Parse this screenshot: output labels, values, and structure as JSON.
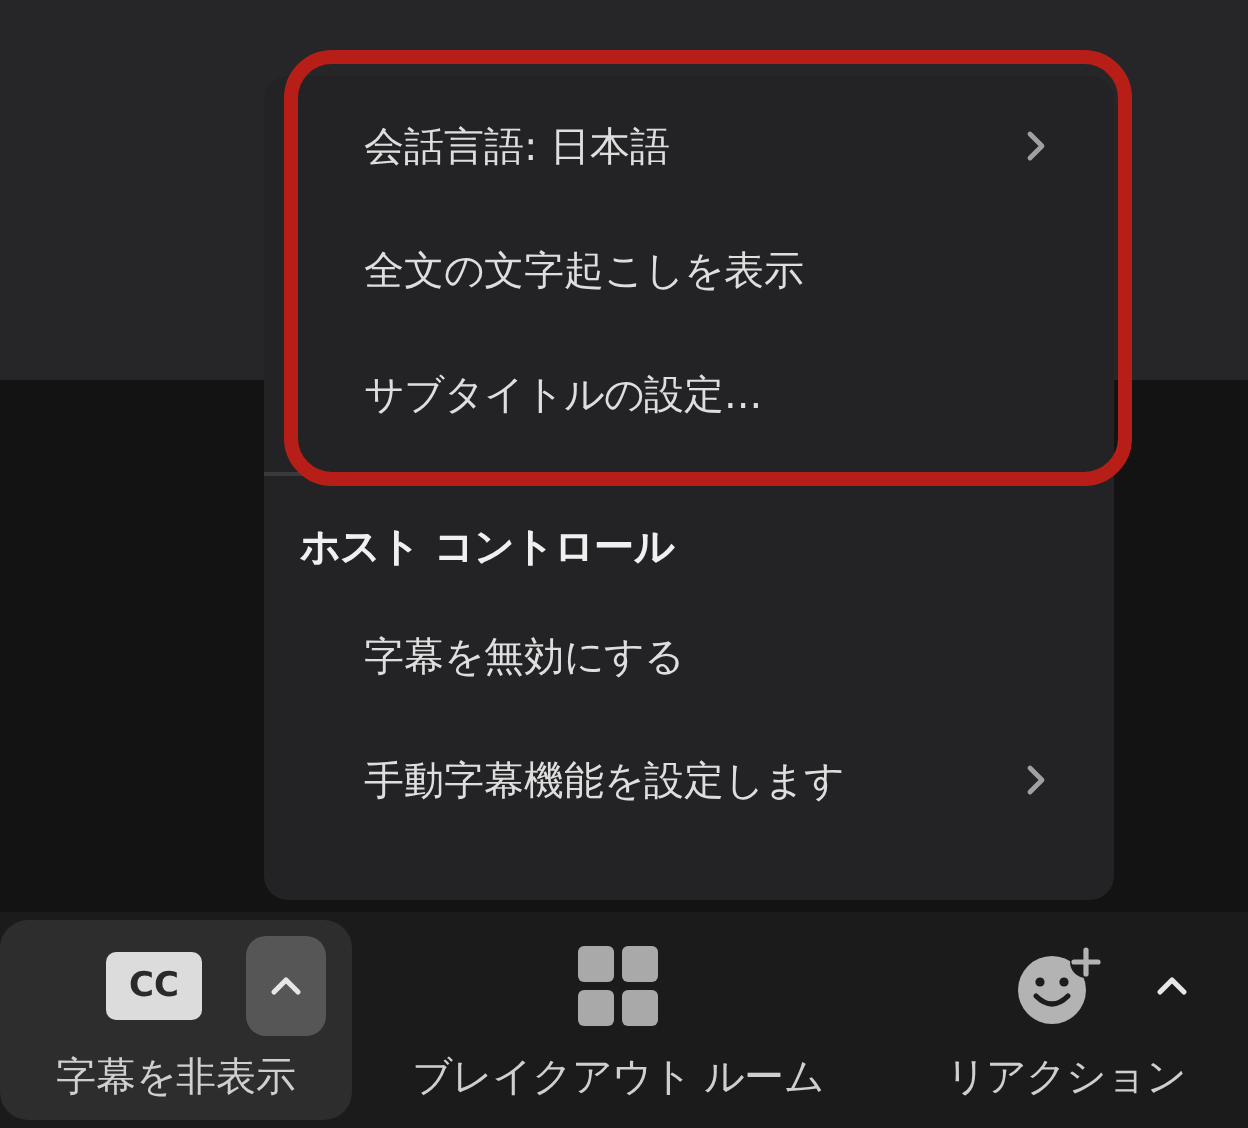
{
  "menu": {
    "sections": [
      {
        "items": [
          {
            "label": "会話言語: 日本語",
            "submenu": true
          },
          {
            "label": "全文の文字起こしを表示",
            "submenu": false
          },
          {
            "label": "サブタイトルの設定...",
            "submenu": false
          }
        ]
      },
      {
        "header": "ホスト コントロール",
        "items": [
          {
            "label": "字幕を無効にする",
            "submenu": false
          },
          {
            "label": "手動字幕機能を設定します",
            "submenu": true
          }
        ]
      }
    ]
  },
  "toolbar": [
    {
      "kind": "captions",
      "label": "字幕を非表示",
      "icon_text": "CC",
      "selected": true,
      "menu": true
    },
    {
      "kind": "breakout",
      "label": "ブレイクアウト ルーム",
      "selected": false,
      "menu": false
    },
    {
      "kind": "reactions",
      "label": "リアクション",
      "selected": false,
      "menu": true
    }
  ]
}
